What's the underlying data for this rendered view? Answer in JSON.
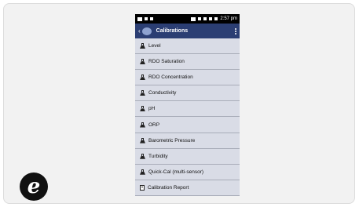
{
  "badge": {
    "letter": "e"
  },
  "statusbar": {
    "time": "2:57 pm"
  },
  "appbar": {
    "title": "Calibrations"
  },
  "rows": [
    {
      "label": "Level",
      "icon": "flask-icon"
    },
    {
      "label": "RDO Saturation",
      "icon": "flask-icon"
    },
    {
      "label": "RDO Concentration",
      "icon": "flask-icon"
    },
    {
      "label": "Conductivity",
      "icon": "flask-icon"
    },
    {
      "label": "pH",
      "icon": "flask-icon"
    },
    {
      "label": "ORP",
      "icon": "flask-icon"
    },
    {
      "label": "Barometric Pressure",
      "icon": "flask-icon"
    },
    {
      "label": "Turbidity",
      "icon": "flask-icon"
    },
    {
      "label": "Quick-Cal (multi-sensor)",
      "icon": "flask-icon"
    },
    {
      "label": "Calibration Report",
      "icon": "report-icon"
    }
  ],
  "colors": {
    "appbar": "#2b3e73",
    "list_bg": "#d9dce6"
  }
}
